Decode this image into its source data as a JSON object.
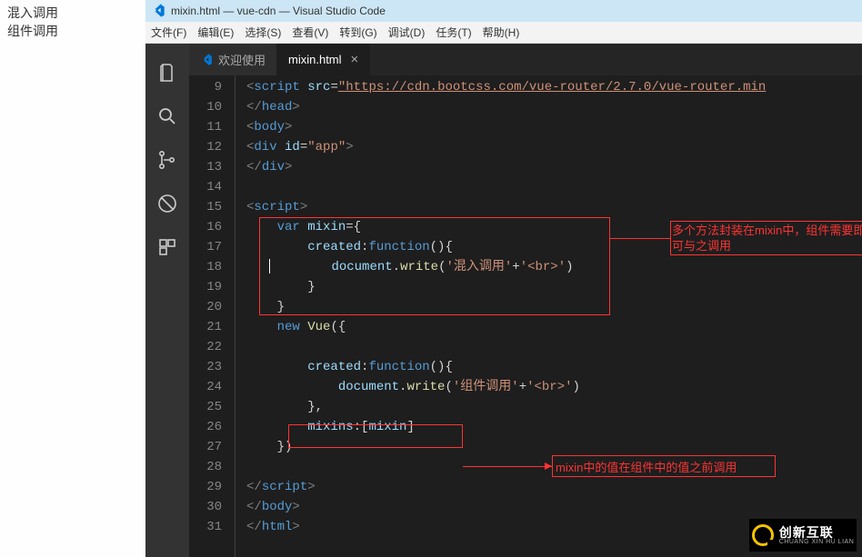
{
  "left_pane": {
    "line1": "混入调用",
    "line2": "组件调用"
  },
  "titlebar": {
    "text": "mixin.html — vue-cdn — Visual Studio Code"
  },
  "menu": {
    "file": "文件(F)",
    "edit": "编辑(E)",
    "select": "选择(S)",
    "view": "查看(V)",
    "goto": "转到(G)",
    "debug": "调试(D)",
    "task": "任务(T)",
    "help": "帮助(H)"
  },
  "tabs": {
    "welcome": "欢迎使用",
    "active": "mixin.html"
  },
  "gutter": [
    "9",
    "10",
    "11",
    "12",
    "13",
    "14",
    "15",
    "16",
    "17",
    "18",
    "19",
    "20",
    "21",
    "22",
    "23",
    "24",
    "25",
    "26",
    "27",
    "28",
    "29",
    "30",
    "31"
  ],
  "code": {
    "l9_src": "\"https://cdn.bootcss.com/vue-router/2.7.0/vue-router.min",
    "l9_tag": "script",
    "l9_attr": "src",
    "l10": "head",
    "l11": "body",
    "l12_tag": "div",
    "l12_attr": "id",
    "l12_val": "\"app\"",
    "l13": "div",
    "l15": "script",
    "l16_var": "var",
    "l16_name": "mixin",
    "l17_created": "created",
    "l17_fn": "function",
    "l18_doc": "document",
    "l18_write": "write",
    "l18_str1": "'混入调用'",
    "l18_plus": "+",
    "l18_str2": "'<br>'",
    "l21_new": "new",
    "l21_vue": "Vue",
    "l23_created": "created",
    "l23_fn": "function",
    "l24_doc": "document",
    "l24_write": "write",
    "l24_str1": "'组件调用'",
    "l24_str2": "'<br>'",
    "l26_mixins": "mixins",
    "l26_val": "mixin",
    "l29": "script",
    "l30": "body",
    "l31": "html"
  },
  "annotations": {
    "anno1": "多个方法封装在mixin中，组件需要即可与之调用",
    "anno2": "mixin中的值在组件中的值之前调用"
  },
  "watermark": {
    "big": "创新互联",
    "small": "CHUANG XIN HU LIAN"
  }
}
